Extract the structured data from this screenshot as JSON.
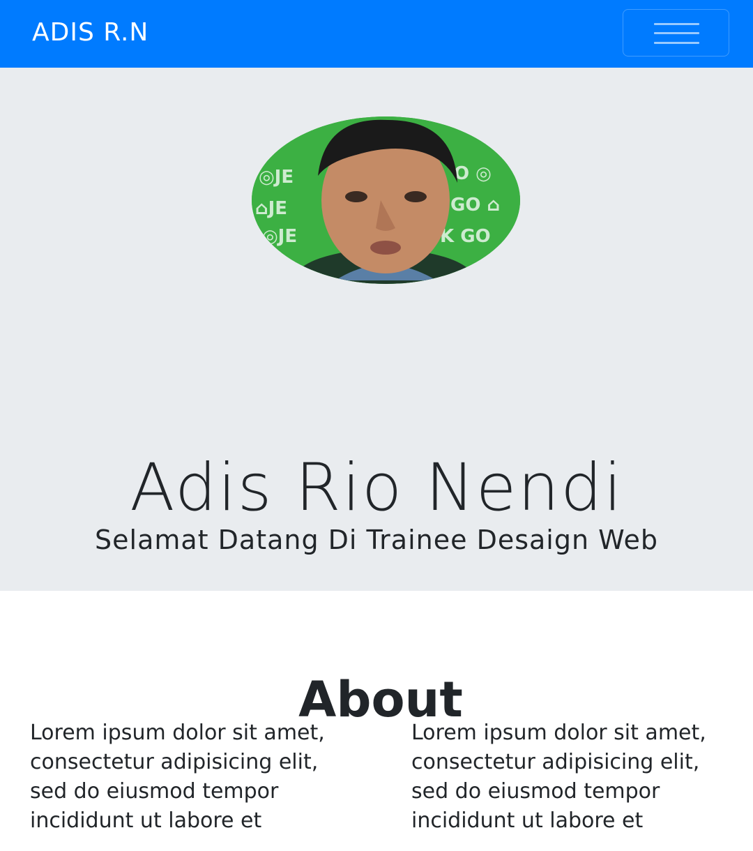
{
  "navbar": {
    "brand": "ADIS R.N",
    "toggler_icon": "hamburger-menu-icon"
  },
  "hero": {
    "avatar_description": "profile-photo",
    "name": "Adis Rio Nendi",
    "subtitle": "Selamat Datang Di Trainee Desaign Web"
  },
  "about": {
    "title": "About",
    "columns": [
      "Lorem ipsum dolor sit amet, consectetur adipisicing elit, sed do eiusmod tempor incididunt ut labore et",
      "Lorem ipsum dolor sit amet, consectetur adipisicing elit, sed do eiusmod tempor incididunt ut labore et"
    ]
  },
  "colors": {
    "navbar": "#007bff",
    "jumbotron": "#e9ecef",
    "text": "#212529"
  }
}
